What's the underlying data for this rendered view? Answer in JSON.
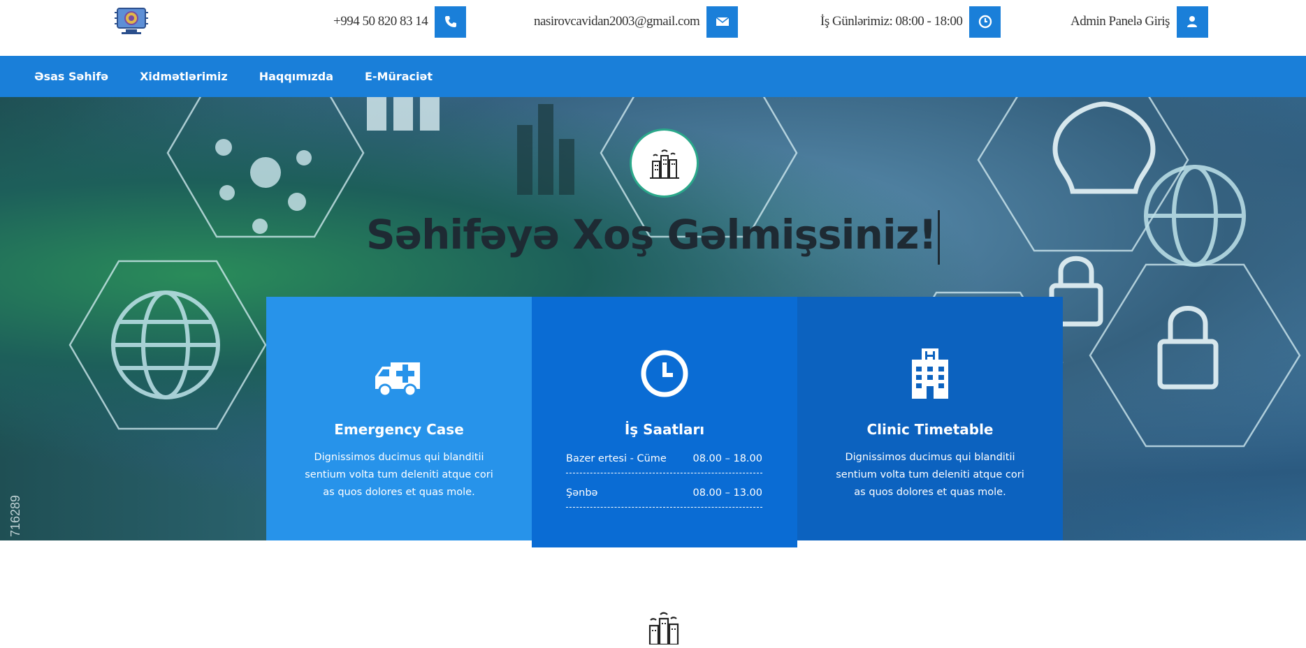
{
  "header": {
    "phone": "+994 50 820 83 14",
    "email": "nasirovcavidan2003@gmail.com",
    "hours": "İş Günlərimiz: 08:00 - 18:00",
    "admin": "Admin Panelə Giriş",
    "icons": [
      "phone-icon",
      "envelope-icon",
      "clock-icon",
      "user-icon"
    ]
  },
  "nav": {
    "items": [
      "Əsas Səhifə",
      "Xidmətlərimiz",
      "Haqqımızda",
      "E-Müraciət"
    ]
  },
  "hero": {
    "title": "Səhifəyə Xoş Gəlmişsiniz!",
    "watermark": "716289"
  },
  "cards": [
    {
      "icon": "ambulance-icon",
      "title": "Emergency Case",
      "desc": "Dignissimos ducimus qui blanditii sentium volta tum deleniti atque cori as quos dolores et quas mole."
    },
    {
      "icon": "clock-icon",
      "title": "İş Saatları",
      "rows": [
        {
          "day": "Bazer ertesi - Cüme",
          "time": "08.00 – 18.00"
        },
        {
          "day": "Şənbə",
          "time": "08.00 – 13.00"
        }
      ]
    },
    {
      "icon": "hospital-icon",
      "title": "Clinic Timetable",
      "desc": "Dignissimos ducimus qui blanditii sentium volta tum deleniti atque cori as quos dolores et quas mole."
    }
  ],
  "colors": {
    "primary": "#1a7fd9",
    "card1": "#2793ea",
    "card2": "#0a6cd4",
    "card3": "#0c62bf",
    "badge_border": "#2aa88a"
  }
}
